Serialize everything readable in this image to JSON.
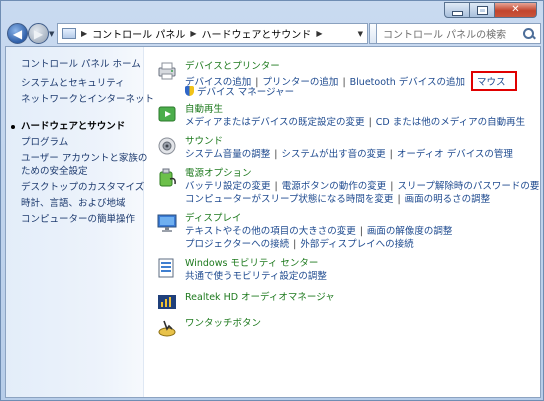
{
  "window": {
    "caption_buttons": {
      "minimize": "minimize",
      "maximize": "maximize",
      "close": "✕"
    }
  },
  "nav": {
    "back_glyph": "◀",
    "forward_glyph": "▶",
    "breadcrumbs": [
      "コントロール パネル",
      "ハードウェアとサウンド"
    ],
    "search_placeholder": "コントロール パネルの検索",
    "refresh_glyph": "↻"
  },
  "left_pane": {
    "items": [
      "コントロール パネル ホーム",
      "システムとセキュリティ",
      "ネットワークとインターネット",
      "ハードウェアとサウンド",
      "プログラム",
      "ユーザー アカウントと家族の",
      "ための安全設定",
      "デスクトップのカスタマイズ",
      "時計、言語、および地域",
      "コンピューターの簡単操作"
    ]
  },
  "categories": {
    "devices": {
      "title": "デバイスとプリンター",
      "links": [
        "デバイスの追加",
        "プリンターの追加",
        "Bluetooth デバイスの追加"
      ],
      "highlighted_link": "マウス",
      "link2": "デバイス マネージャー"
    },
    "autoplay": {
      "title": "自動再生",
      "links": [
        "メディアまたはデバイスの既定設定の変更",
        "CD または他のメディアの自動再生"
      ]
    },
    "sound": {
      "title": "サウンド",
      "links": [
        "システム音量の調整",
        "システムが出す音の変更",
        "オーディオ デバイスの管理"
      ]
    },
    "power": {
      "title": "電源オプション",
      "links1": [
        "バッテリ設定の変更",
        "電源ボタンの動作の変更",
        "スリープ解除時のパスワードの要求"
      ],
      "links2": [
        "コンピューターがスリープ状態になる時間を変更",
        "画面の明るさの調整"
      ]
    },
    "display": {
      "title": "ディスプレイ",
      "links1": [
        "テキストやその他の項目の大きさの変更",
        "画面の解像度の調整"
      ],
      "links2": [
        "プロジェクターへの接続",
        "外部ディスプレイへの接続"
      ]
    },
    "mobility": {
      "title": "Windows モビリティ センター",
      "links": [
        "共通で使うモビリティ設定の調整"
      ]
    },
    "realtek": {
      "title": "Realtek HD オーディオマネージャ"
    },
    "onetouch": {
      "title": "ワンタッチボタン"
    }
  },
  "colors": {
    "highlight_border": "#e00000",
    "category_title": "#1e7a1e",
    "link": "#1e4a8f"
  }
}
